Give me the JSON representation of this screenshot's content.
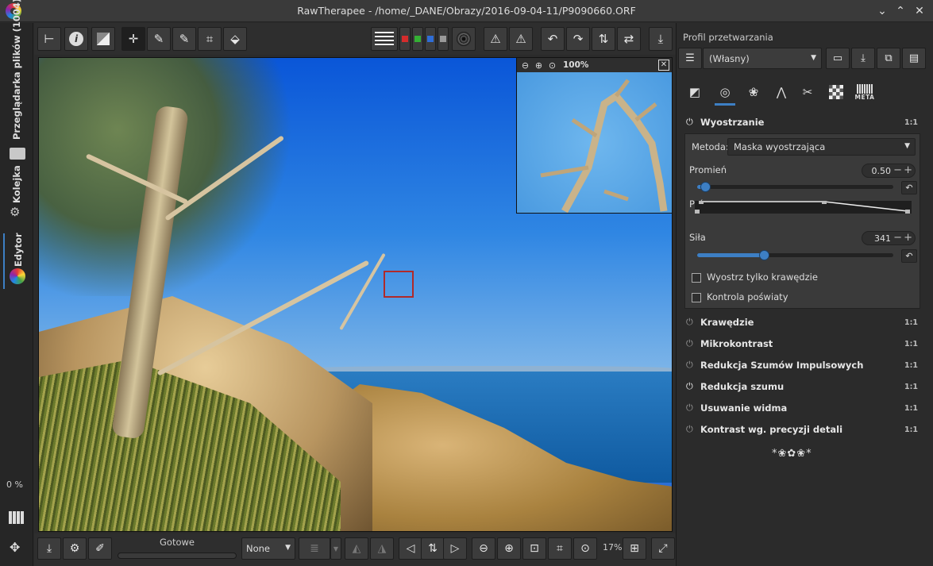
{
  "window": {
    "title": "RawTherapee - /home/_DANE/Obrazy/2016-09-04-11/P9090660.ORF"
  },
  "left_tabs": [
    {
      "label": "Przeglądarka plików (1004)",
      "icon": "folder-icon"
    },
    {
      "label": "Kolejka",
      "icon": "gears-icon"
    },
    {
      "label": "Edytor",
      "icon": "color-wheel-icon"
    }
  ],
  "left_progress": "0 %",
  "detail_window": {
    "zoom": "100%"
  },
  "bottom": {
    "status": "Gotowe",
    "progress": 0,
    "preset": "None",
    "zoom": "17%"
  },
  "right_panel": {
    "profile_title": "Profil przetwarzania",
    "profile_value": "(Własny)",
    "tool_tabs": [
      "exposure-icon",
      "detail-icon",
      "color-icon",
      "advanced-icon",
      "transform-icon",
      "raw-icon",
      "META"
    ],
    "sections": [
      {
        "title": "Wyostrzanie",
        "badge": "1:1",
        "enabled": true,
        "expanded": true
      },
      {
        "title": "Krawędzie",
        "badge": "1:1",
        "enabled": false
      },
      {
        "title": "Mikrokontrast",
        "badge": "1:1",
        "enabled": false
      },
      {
        "title": "Redukcja Szumów Impulsowych",
        "badge": "1:1",
        "enabled": false
      },
      {
        "title": "Redukcja szumu",
        "badge": "1:1",
        "enabled": true
      },
      {
        "title": "Usuwanie widma",
        "badge": "1:1",
        "enabled": false
      },
      {
        "title": "Kontrast wg. precyzji detali",
        "badge": "1:1",
        "enabled": false
      }
    ],
    "sharpening": {
      "method_label": "Metoda:",
      "method_value": "Maska wyostrzająca",
      "radius_label": "Promień",
      "radius_value": "0.50",
      "radius_fraction": 0.04,
      "threshold_label": "Próg",
      "amount_label": "Siła",
      "amount_value": "341",
      "amount_fraction": 0.34,
      "edges_only_label": "Wyostrz tylko krawędzie",
      "halo_control_label": "Kontrola poświaty"
    },
    "ornament": "*❀✿❀*"
  },
  "colors": {
    "accent": "#3d7fc4",
    "selection": "#b02a2a"
  }
}
